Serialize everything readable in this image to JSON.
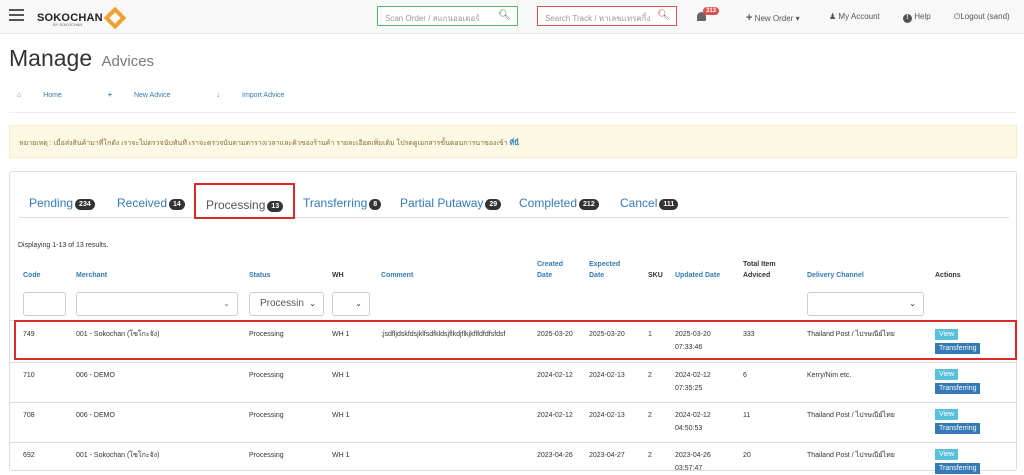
{
  "app": {
    "logo_text": "SOKOCHAN",
    "logo_sub": "BY SOKOCHAN"
  },
  "header": {
    "scan_placeholder": "Scan Order / สแกนออเดอร์",
    "track_placeholder": "Search Track / หาเลขแทรคกิ้ง",
    "notif_count": "313",
    "new_order": "New Order",
    "my_account": "My Account",
    "help": "Help",
    "logout": "Logout (sand)"
  },
  "page": {
    "title": "Manage",
    "subtitle": "Advices"
  },
  "actions": {
    "home": "Home",
    "new_advice": "New Advice",
    "import_advice": "Import Advice"
  },
  "alert": {
    "text": "หมายเหตุ : เมื่อส่งสินค้ามาที่โกดัง เราจะไม่ตรวจนับทันที เราจะตรวจนับตามตารางเวลาและคิวของร้านค้า รายละเอียดเพิ่มเติม โปรดดูเอกสารขั้นตอนการนาของเข้า",
    "link": "ที่นี่"
  },
  "tabs": [
    {
      "label": "Pending",
      "count": "234"
    },
    {
      "label": "Received",
      "count": "14"
    },
    {
      "label": "Processing",
      "count": "13"
    },
    {
      "label": "Transferring",
      "count": "8"
    },
    {
      "label": "Partial Putaway",
      "count": "29"
    },
    {
      "label": "Completed",
      "count": "212"
    },
    {
      "label": "Cancel",
      "count": "111"
    }
  ],
  "summary": "Displaying 1-13 of 13 results.",
  "columns": {
    "code": "Code",
    "merchant": "Merchant",
    "status": "Status",
    "wh": "WH",
    "comment": "Comment",
    "created": "Created Date",
    "expected": "Expected Date",
    "sku": "SKU",
    "updated": "Updated Date",
    "total": "Total Item Adviced",
    "delivery": "Delivery Channel",
    "actions": "Actions"
  },
  "filters": {
    "status_value": "Processin"
  },
  "buttons": {
    "view": "View",
    "transferring": "Transferring"
  },
  "rows": [
    {
      "code": "749",
      "merchant": "001 - Sokochan (โซโกะจัง)",
      "status": "Processing",
      "wh": "WH 1",
      "comment": ";jsdfljdskfdsjklfsdfkldsjflkdjflkjkflfdfdfsfdsf",
      "created": "2025-03-20",
      "expected": "2025-03-20",
      "sku": "1",
      "updated": "2025-03-20 07:33:46",
      "total": "333",
      "delivery": "Thailand Post / ไปรษณีย์ไทย"
    },
    {
      "code": "710",
      "merchant": "006 - DEMO",
      "status": "Processing",
      "wh": "WH 1",
      "comment": "",
      "created": "2024-02-12",
      "expected": "2024-02-13",
      "sku": "2",
      "updated": "2024-02-12 07:35:25",
      "total": "6",
      "delivery": "Kerry/Nim etc."
    },
    {
      "code": "708",
      "merchant": "006 - DEMO",
      "status": "Processing",
      "wh": "WH 1",
      "comment": "",
      "created": "2024-02-12",
      "expected": "2024-02-13",
      "sku": "2",
      "updated": "2024-02-12 04:50:53",
      "total": "11",
      "delivery": "Thailand Post / ไปรษณีย์ไทย"
    },
    {
      "code": "692",
      "merchant": "001 - Sokochan (โซโกะจัง)",
      "status": "Processing",
      "wh": "WH 1",
      "comment": "",
      "created": "2023-04-26",
      "expected": "2023-04-27",
      "sku": "2",
      "updated": "2023-04-26 03:57:47",
      "total": "20",
      "delivery": "Thailand Post / ไปรษณีย์ไทย"
    }
  ]
}
